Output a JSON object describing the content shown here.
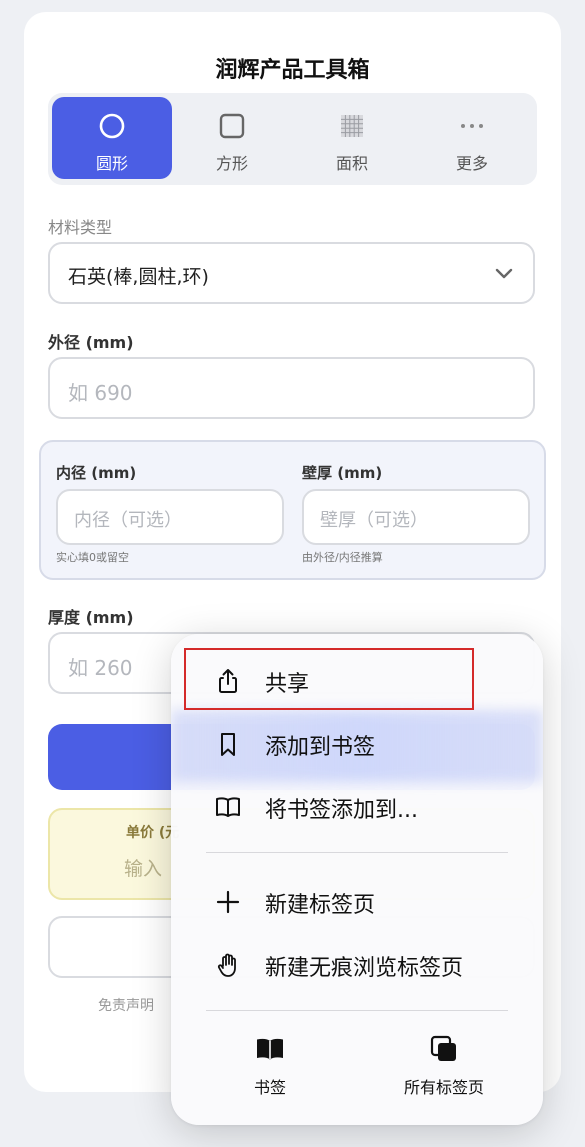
{
  "app": {
    "title": "润辉产品工具箱"
  },
  "tabs": [
    {
      "label": "圆形",
      "icon": "circle-icon",
      "active": true
    },
    {
      "label": "方形",
      "icon": "square-icon",
      "active": false
    },
    {
      "label": "面积",
      "icon": "grid-icon",
      "active": false
    },
    {
      "label": "更多",
      "icon": "more-icon",
      "active": false
    }
  ],
  "form": {
    "material_label": "材料类型",
    "material_value": "石英(棒,圆柱,环)",
    "outer_label": "外径 (mm)",
    "outer_placeholder": "如 690",
    "inner_label": "内径 (mm)",
    "inner_placeholder": "内径（可选）",
    "inner_hint": "实心填0或留空",
    "wall_label": "壁厚 (mm)",
    "wall_placeholder": "壁厚（可选）",
    "wall_hint": "由外径/内径推算",
    "thickness_label": "厚度 (mm)",
    "thickness_placeholder": "如 260",
    "price_label": "单价 (元",
    "price_input": "输入",
    "disclaimer": "免责声明"
  },
  "menu": {
    "items": [
      {
        "label": "共享",
        "icon": "share-icon"
      },
      {
        "label": "添加到书签",
        "icon": "bookmark-icon"
      },
      {
        "label": "将书签添加到...",
        "icon": "book-open-icon"
      },
      {
        "label": "新建标签页",
        "icon": "plus-icon"
      },
      {
        "label": "新建无痕浏览标签页",
        "icon": "hand-icon"
      }
    ],
    "bottom": [
      {
        "label": "书签",
        "icon": "book-filled-icon"
      },
      {
        "label": "所有标签页",
        "icon": "tabs-icon"
      }
    ]
  },
  "colors": {
    "accent": "#4b5ee4",
    "highlight_border": "#d42a2a",
    "price_box": "#fbf8dd"
  }
}
